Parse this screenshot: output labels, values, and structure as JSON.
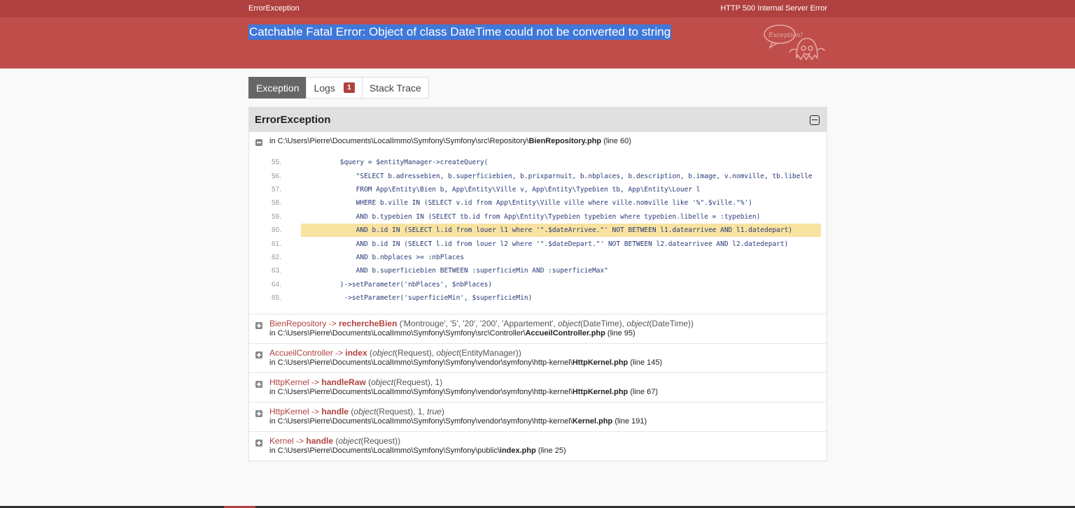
{
  "topbar": {
    "exception_class": "ErrorException",
    "http_status": "HTTP 500",
    "status_text": "Internal Server Error"
  },
  "header": {
    "message": "Catchable Fatal Error: Object of class DateTime could not be converted to string",
    "logo_text": "Exception!"
  },
  "tabs": [
    {
      "label": "Exception",
      "active": true
    },
    {
      "label": "Logs",
      "badge": "1"
    },
    {
      "label": "Stack Trace"
    }
  ],
  "panel": {
    "title": "ErrorException",
    "first_trace": {
      "path": "in C:\\Users\\Pierre\\Documents\\LocalImmo\\Symfony\\Symfony\\src\\Repository\\",
      "file": "BienRepository.php",
      "line": "(line 60)"
    },
    "code_lines": [
      {
        "num": "55.",
        "text": "        $query = $entityManager->createQuery("
      },
      {
        "num": "56.",
        "text": "            \"SELECT b.adressebien, b.superficiebien, b.prixparnuit, b.nbplaces, b.description, b.image, v.nomville, tb.libelle"
      },
      {
        "num": "57.",
        "text": "            FROM App\\Entity\\Bien b, App\\Entity\\Ville v, App\\Entity\\Typebien tb, App\\Entity\\Louer l"
      },
      {
        "num": "58.",
        "text": "            WHERE b.ville IN (SELECT v.id from App\\Entity\\Ville ville where ville.nomville like '%\".$ville.\"%')"
      },
      {
        "num": "59.",
        "text": "            AND b.typebien IN (SELECT tb.id from App\\Entity\\Typebien typebien where typebien.libelle = :typebien)"
      },
      {
        "num": "60.",
        "text": "            AND b.id IN (SELECT l.id from louer l1 where '\".$dateArrivee.\"' NOT BETWEEN l1.datearrivee AND l1.datedepart)",
        "highlight": true
      },
      {
        "num": "61.",
        "text": "            AND b.id IN (SELECT l.id from louer l2 where '\".$dateDepart.\"' NOT BETWEEN l2.datearrivee AND l2.datedepart)"
      },
      {
        "num": "62.",
        "text": "            AND b.nbplaces >= :nbPlaces"
      },
      {
        "num": "63.",
        "text": "            AND b.superficiebien BETWEEN :superficieMin AND :superficieMax\""
      },
      {
        "num": "64.",
        "text": "        )->setParameter('nbPlaces', $nbPlaces)"
      },
      {
        "num": "65.",
        "text": "         ->setParameter('superficieMin', $superficieMin)"
      }
    ],
    "traces": [
      {
        "cls": "BienRepository",
        "arrow": " -> ",
        "fn": "rechercheBien",
        "args": " ('Montrouge', '5', '20', '200', 'Appartement', object(DateTime), object(DateTime))",
        "path": "in C:\\Users\\Pierre\\Documents\\LocalImmo\\Symfony\\Symfony\\src\\Controller\\",
        "file": "AccueilController.php",
        "line": " (line 95)"
      },
      {
        "cls": "AccueilController",
        "arrow": " -> ",
        "fn": "index",
        "args": " (object(Request), object(EntityManager))",
        "path": "in C:\\Users\\Pierre\\Documents\\LocalImmo\\Symfony\\Symfony\\vendor\\symfony\\http-kernel\\",
        "file": "HttpKernel.php",
        "line": " (line 145)"
      },
      {
        "cls": "HttpKernel",
        "arrow": " -> ",
        "fn": "handleRaw",
        "args": " (object(Request), 1)",
        "path": "in C:\\Users\\Pierre\\Documents\\LocalImmo\\Symfony\\Symfony\\vendor\\symfony\\http-kernel\\",
        "file": "HttpKernel.php",
        "line": " (line 67)"
      },
      {
        "cls": "HttpKernel",
        "arrow": " -> ",
        "fn": "handle",
        "args": " (object(Request), 1, true)",
        "path": "in C:\\Users\\Pierre\\Documents\\LocalImmo\\Symfony\\Symfony\\vendor\\symfony\\http-kernel\\",
        "file": "Kernel.php",
        "line": " (line 191)"
      },
      {
        "cls": "Kernel",
        "arrow": " -> ",
        "fn": "handle",
        "args": " (object(Request))",
        "path": "in C:\\Users\\Pierre\\Documents\\LocalImmo\\Symfony\\Symfony\\public\\",
        "file": "index.php",
        "line": " (line 25)"
      }
    ]
  },
  "colors": {
    "accent": "#b0413e",
    "header": "#bf4e4b",
    "highlight": "#f8e3a0",
    "code": "#273a77"
  }
}
